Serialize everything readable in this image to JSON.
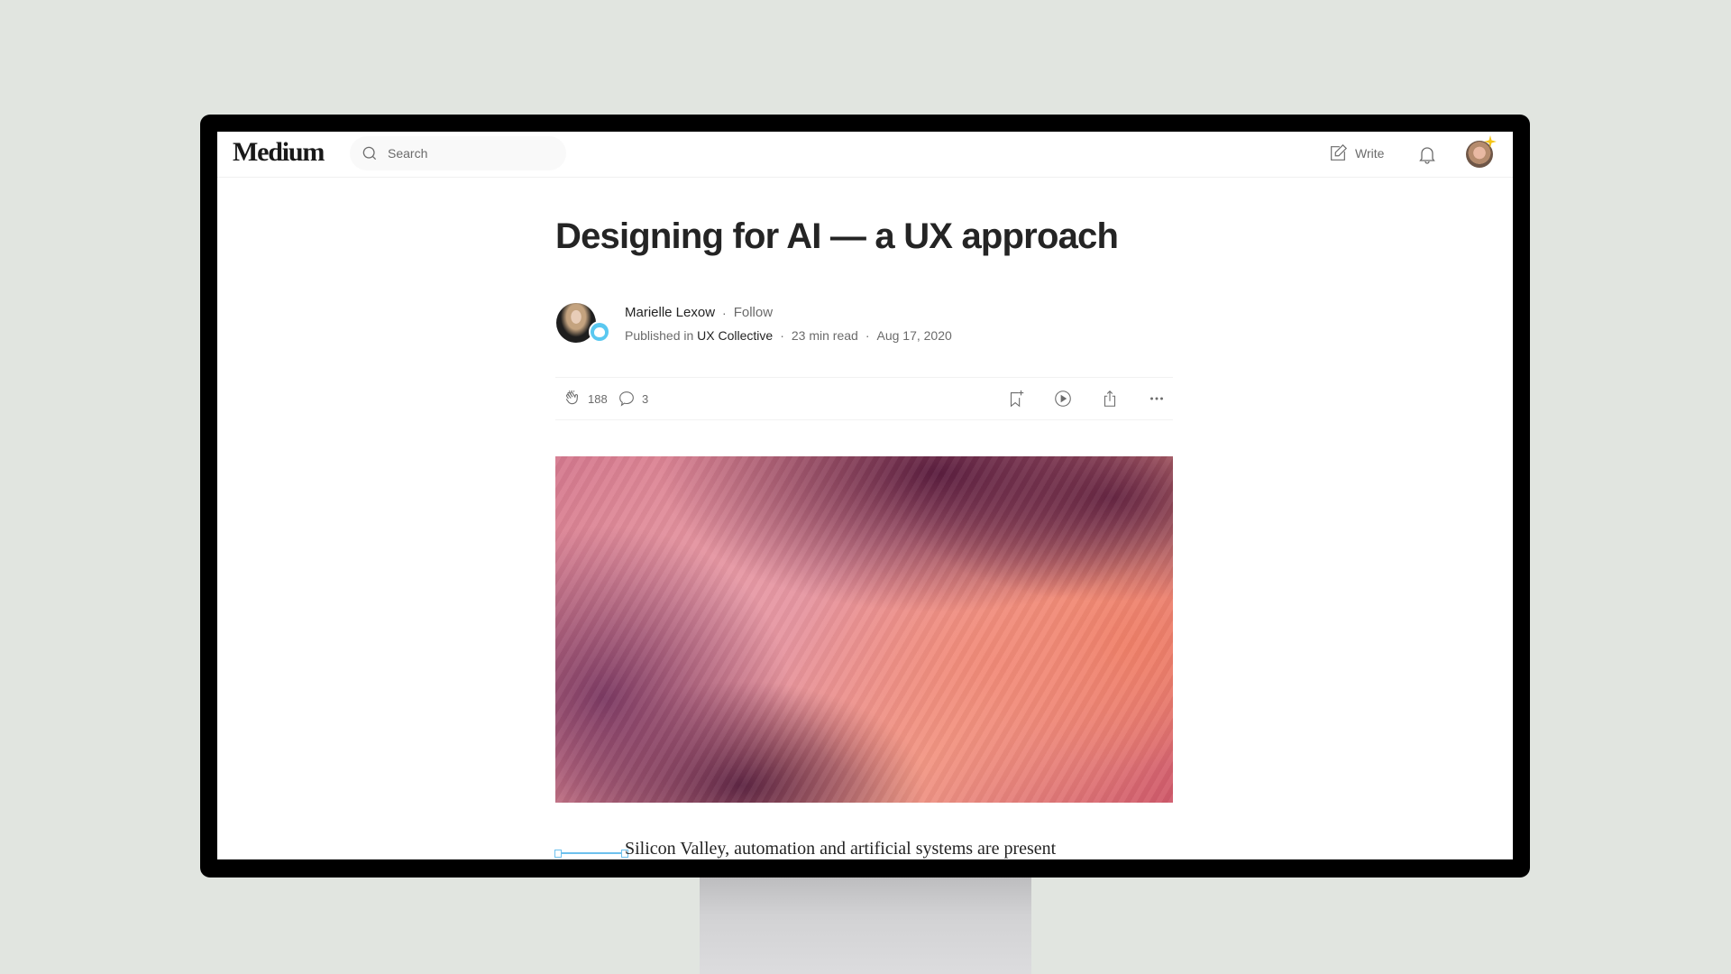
{
  "app": {
    "logo": "Medium",
    "search": {
      "placeholder": "Search",
      "icon": "search-icon"
    },
    "write_label": "Write",
    "icons": [
      "write-icon",
      "bell-icon",
      "profile-avatar"
    ]
  },
  "article": {
    "title": "Designing for AI — a UX approach",
    "author": "Marielle Lexow",
    "follow_label": "Follow",
    "published_in_label": "Published in",
    "publication": "UX Collective",
    "read_time": "23 min read",
    "date": "Aug 17, 2020",
    "separator": "·",
    "claps": "188",
    "responses": "3",
    "actions": [
      "save-icon",
      "listen-icon",
      "share-icon",
      "more-icon"
    ],
    "first_line": "Silicon Valley, automation and artificial systems are present"
  },
  "colors": {
    "background": "#e1e5e0",
    "text_primary": "#242424",
    "text_secondary": "#6b6b6b",
    "badge_star": "#f5c518",
    "publication_badge": "#5ac8f0"
  }
}
